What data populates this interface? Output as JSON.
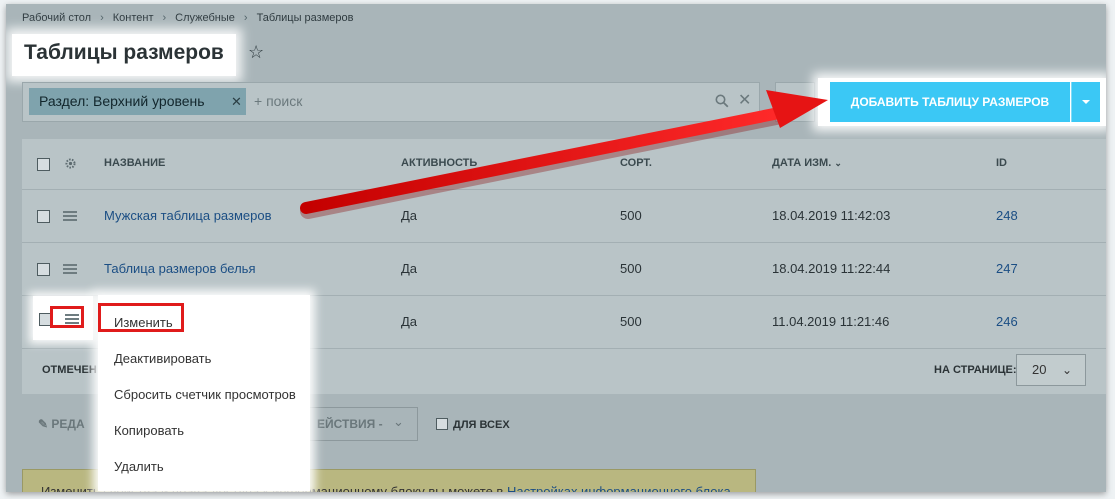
{
  "breadcrumb": [
    "Рабочий стол",
    "Контент",
    "Служебные",
    "Таблицы размеров"
  ],
  "page_title": "Таблицы размеров",
  "filter": {
    "chip_label": "Раздел: Верхний уровень",
    "search_placeholder": "+ поиск"
  },
  "add_button_label": "ДОБАВИТЬ ТАБЛИЦУ РАЗМЕРОВ",
  "grid": {
    "columns": [
      "НАЗВАНИЕ",
      "АКТИВНОСТЬ",
      "СОРТ.",
      "ДАТА ИЗМ.",
      "ID"
    ],
    "rows": [
      {
        "name": "Мужская таблица размеров",
        "active": "Да",
        "sort": "500",
        "date": "18.04.2019 11:42:03",
        "id": "248"
      },
      {
        "name": "Таблица размеров белья",
        "active": "Да",
        "sort": "500",
        "date": "18.04.2019 11:22:44",
        "id": "247"
      },
      {
        "name": "",
        "active": "Да",
        "sort": "500",
        "date": "11.04.2019 11:21:46",
        "id": "246"
      }
    ]
  },
  "context_menu": [
    "Изменить",
    "Деактивировать",
    "Сбросить счетчик просмотров",
    "Копировать",
    "Удалить"
  ],
  "footer": {
    "selected_label_partial": "ОТМЕЧЕН",
    "per_page_label": "НА СТРАНИЦЕ:",
    "per_page_value": "20",
    "edit_partial": "РЕДА",
    "actions_partial": "ЕЙСТВИЯ -",
    "for_all_label": "ДЛЯ ВСЕХ"
  },
  "notice": {
    "text": "Изменить свойства и права доступа к информационному блоку вы можете в",
    "link": "Настройках информационного блока"
  },
  "colors": {
    "accent": "#3bc8f5",
    "highlight_red": "#e01b1b",
    "link": "#1b4e84"
  }
}
